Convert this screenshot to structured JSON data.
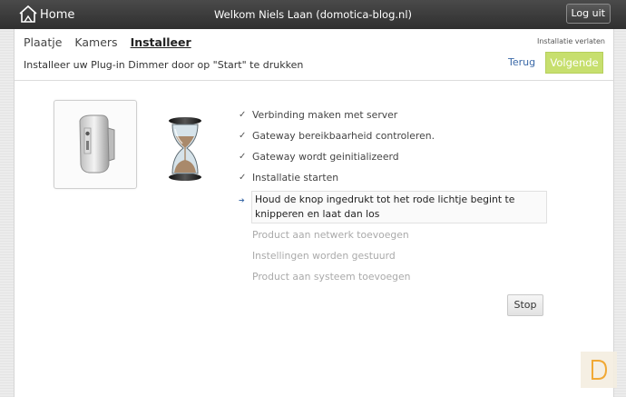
{
  "header": {
    "home_label": "Home",
    "welcome_text": "Welkom Niels Laan (domotica-blog.nl)",
    "logout_label": "Log uit"
  },
  "tabs": [
    {
      "label": "Plaatje",
      "active": false
    },
    {
      "label": "Kamers",
      "active": false
    },
    {
      "label": "Installeer",
      "active": true
    }
  ],
  "leave_label": "Installatie verlaten",
  "instruction": "Installeer uw Plug-in Dimmer door op \"Start\" te drukken",
  "nav": {
    "back_label": "Terug",
    "next_label": "Volgende"
  },
  "steps": [
    {
      "text": "Verbinding maken met server",
      "status": "done",
      "mark": "✓"
    },
    {
      "text": "Gateway bereikbaarheid controleren.",
      "status": "done",
      "mark": "✓"
    },
    {
      "text": "Gateway wordt geinitializeerd",
      "status": "done",
      "mark": "✓"
    },
    {
      "text": "Installatie starten",
      "status": "done",
      "mark": "✓"
    },
    {
      "text": "Houd de knop ingedrukt tot het rode lichtje begint te knipperen en laat dan los",
      "status": "current",
      "mark": "➔"
    },
    {
      "text": "Product aan netwerk toevoegen",
      "status": "pending",
      "mark": ""
    },
    {
      "text": "Instellingen worden gestuurd",
      "status": "pending",
      "mark": ""
    },
    {
      "text": "Product aan systeem toevoegen",
      "status": "pending",
      "mark": ""
    }
  ],
  "stop_label": "Stop",
  "icons": {
    "home": "home-icon",
    "product": "plug-in-dimmer-image",
    "busy": "hourglass-icon",
    "badge": "domotica-logo-icon"
  },
  "colors": {
    "accent_green": "#c7df6e",
    "link_blue": "#3c6aa8",
    "header_dark": "#3a3a3a"
  }
}
